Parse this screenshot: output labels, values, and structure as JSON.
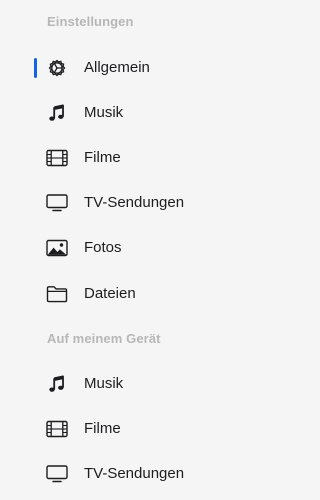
{
  "sections": [
    {
      "header": "Einstellungen",
      "items": [
        {
          "label": "Allgemein",
          "icon": "gear-icon",
          "selected": true
        },
        {
          "label": "Musik",
          "icon": "music-note-icon"
        },
        {
          "label": "Filme",
          "icon": "film-icon"
        },
        {
          "label": "TV-Sendungen",
          "icon": "tv-icon"
        },
        {
          "label": "Fotos",
          "icon": "photo-icon"
        },
        {
          "label": "Dateien",
          "icon": "folder-icon"
        }
      ]
    },
    {
      "header": "Auf meinem Gerät",
      "items": [
        {
          "label": "Musik",
          "icon": "music-note-icon"
        },
        {
          "label": "Filme",
          "icon": "film-icon"
        },
        {
          "label": "TV-Sendungen",
          "icon": "tv-icon"
        }
      ]
    }
  ],
  "colors": {
    "accent": "#1463e0",
    "background": "#f5f5f5",
    "header_text": "#b7b7b7",
    "item_text": "#1d1d1f"
  }
}
